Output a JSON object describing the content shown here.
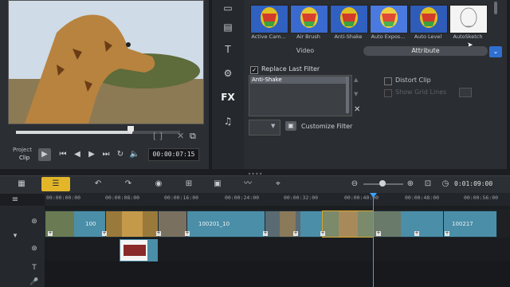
{
  "preview": {
    "project_label": "Project",
    "clip_label": "Clip",
    "timecode": "00:00:07:15"
  },
  "library": {
    "filters": [
      {
        "label": "Active Cam..."
      },
      {
        "label": "Air Brush"
      },
      {
        "label": "Anti-Shake"
      },
      {
        "label": "Auto Expos..."
      },
      {
        "label": "Auto Level"
      },
      {
        "label": "AutoSketch"
      }
    ],
    "tabs": {
      "video": "Video",
      "attribute": "Attribute"
    },
    "replace_last_filter": "Replace Last Filter",
    "applied_filters": [
      "Anti-Shake"
    ],
    "distort_clip": "Distort Clip",
    "show_grid_lines": "Show Grid Lines",
    "customize_filter": "Customize Filter"
  },
  "timeline": {
    "timecode": "0:01:09:00",
    "ruler_ticks": [
      "00:00:00:00",
      "00:00:08:00",
      "00:00:16:00",
      "00:00:24:00",
      "00:00:32:00",
      "00:00:40:00",
      "00:00:48:00",
      "00:00:56:00"
    ],
    "clips": [
      {
        "label": "100"
      },
      {
        "label": ""
      },
      {
        "label": ""
      },
      {
        "label": "100201_10"
      },
      {
        "label": ""
      },
      {
        "label": ""
      },
      {
        "label": ""
      },
      {
        "label": "100217"
      }
    ]
  },
  "colors": {
    "accent_blue": "#3fa1ff",
    "storyboard_yellow": "#e3b62a",
    "clip_teal": "#4b8ea8"
  }
}
